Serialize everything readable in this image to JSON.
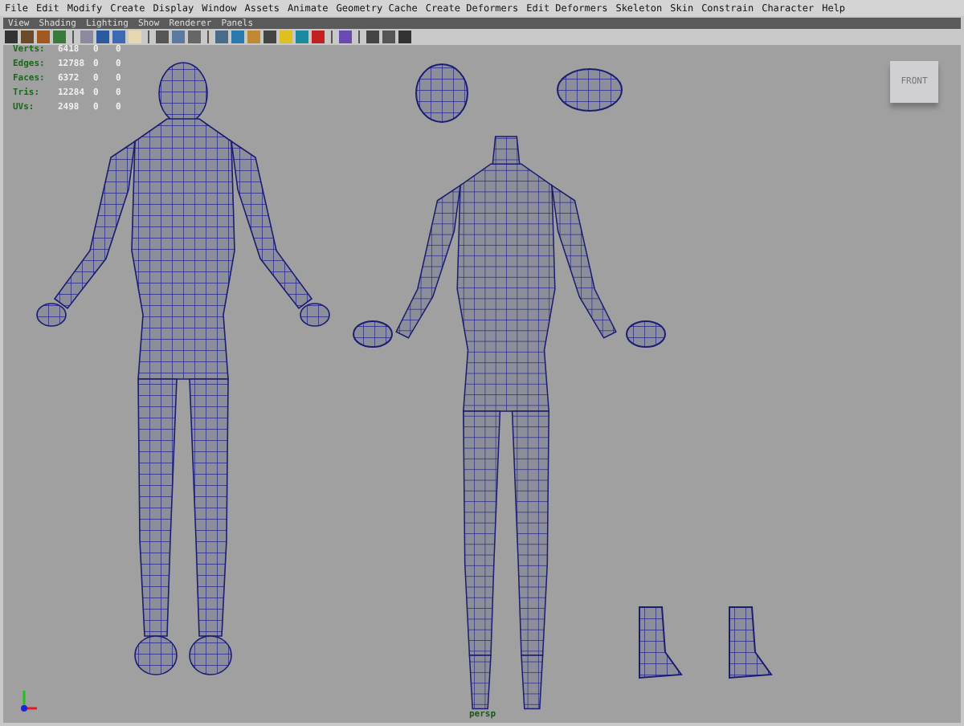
{
  "main_menu": [
    "File",
    "Edit",
    "Modify",
    "Create",
    "Display",
    "Window",
    "Assets",
    "Animate",
    "Geometry Cache",
    "Create Deformers",
    "Edit Deformers",
    "Skeleton",
    "Skin",
    "Constrain",
    "Character",
    "Help"
  ],
  "panel_menu": [
    "View",
    "Shading",
    "Lighting",
    "Show",
    "Renderer",
    "Panels"
  ],
  "poly_count": [
    {
      "label": "Verts:",
      "values": [
        "6418",
        "0",
        "0"
      ]
    },
    {
      "label": "Edges:",
      "values": [
        "12788",
        "0",
        "0"
      ]
    },
    {
      "label": "Faces:",
      "values": [
        "6372",
        "0",
        "0"
      ]
    },
    {
      "label": "Tris:",
      "values": [
        "12284",
        "0",
        "0"
      ]
    },
    {
      "label": "UVs:",
      "values": [
        "2498",
        "0",
        "0"
      ]
    }
  ],
  "view_cube": {
    "label": "FRONT"
  },
  "camera_name": "persp"
}
